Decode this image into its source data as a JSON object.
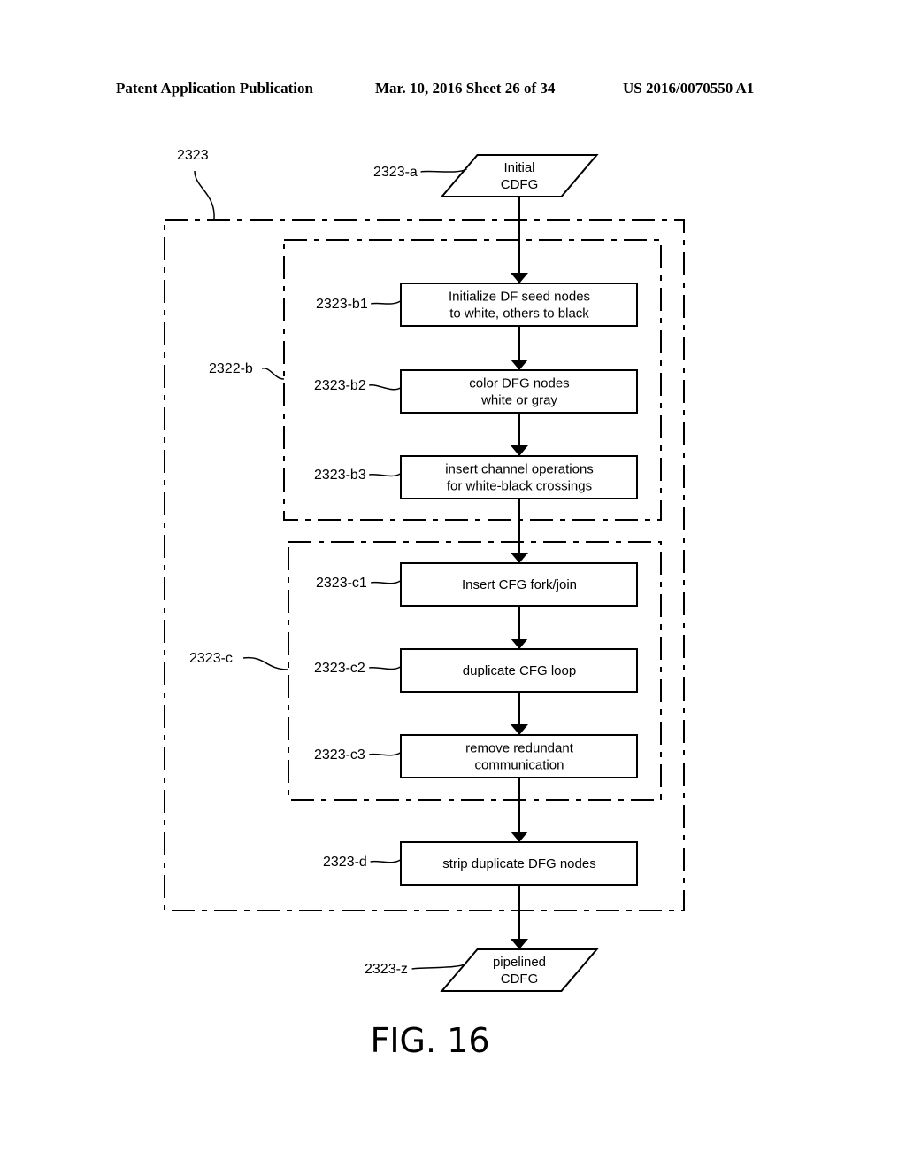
{
  "header": {
    "publication": "Patent Application Publication",
    "date_sheet": "Mar. 10, 2016  Sheet 26 of 34",
    "number": "US 2016/0070550 A1"
  },
  "diagram": {
    "outer_group_label": "2323",
    "group_b_label": "2322-b",
    "group_c_label": "2323-c",
    "nodes": {
      "a": {
        "ref": "2323-a",
        "lines": [
          "Initial",
          "CDFG"
        ],
        "shape": "parallelogram"
      },
      "b1": {
        "ref": "2323-b1",
        "lines": [
          "Initialize DF seed nodes",
          "to white, others to black"
        ],
        "shape": "rect"
      },
      "b2": {
        "ref": "2323-b2",
        "lines": [
          "color DFG nodes",
          "white or gray"
        ],
        "shape": "rect"
      },
      "b3": {
        "ref": "2323-b3",
        "lines": [
          "insert channel operations",
          "for white-black crossings"
        ],
        "shape": "rect"
      },
      "c1": {
        "ref": "2323-c1",
        "lines": [
          "Insert CFG fork/join"
        ],
        "shape": "rect"
      },
      "c2": {
        "ref": "2323-c2",
        "lines": [
          "duplicate CFG loop"
        ],
        "shape": "rect"
      },
      "c3": {
        "ref": "2323-c3",
        "lines": [
          "remove redundant",
          "communication"
        ],
        "shape": "rect"
      },
      "d": {
        "ref": "2323-d",
        "lines": [
          "strip duplicate DFG nodes"
        ],
        "shape": "rect"
      },
      "z": {
        "ref": "2323-z",
        "lines": [
          "pipelined",
          "CDFG"
        ],
        "shape": "parallelogram"
      }
    },
    "edges": [
      [
        "a",
        "b1"
      ],
      [
        "b1",
        "b2"
      ],
      [
        "b2",
        "b3"
      ],
      [
        "b3",
        "c1"
      ],
      [
        "c1",
        "c2"
      ],
      [
        "c2",
        "c3"
      ],
      [
        "c3",
        "d"
      ],
      [
        "d",
        "z"
      ]
    ],
    "figure_label": "FIG. 16"
  }
}
